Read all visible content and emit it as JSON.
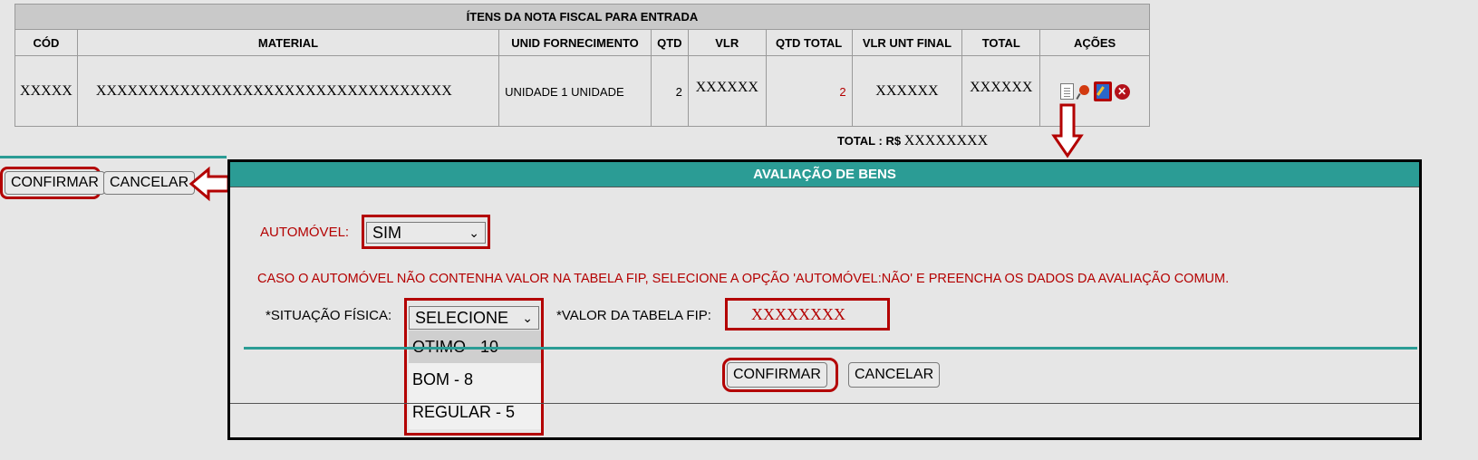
{
  "items_table": {
    "title": "ÍTENS DA NOTA FISCAL PARA ENTRADA",
    "columns": [
      "CÓD",
      "MATERIAL",
      "UNID FORNECIMENTO",
      "QTD",
      "VLR",
      "QTD TOTAL",
      "VLR UNT FINAL",
      "TOTAL",
      "AÇÕES"
    ],
    "row": {
      "cod": "XXXXX",
      "material": "XXXXXXXXXXXXXXXXXXXXXXXXXXXXXXXXXX",
      "unid": "UNIDADE 1 UNIDADE",
      "qtd": "2",
      "vlr": "XXXXXX",
      "qtd_total": "2",
      "vlr_unt_final": "XXXXXX",
      "total": "XXXXXX"
    },
    "action_icons": [
      "document-icon",
      "pin-icon",
      "edit-icon",
      "delete-icon"
    ]
  },
  "total": {
    "label": "TOTAL : R$",
    "value": "XXXXXXXX"
  },
  "left_buttons": {
    "confirm": "CONFIRMAR",
    "cancel": "CANCELAR"
  },
  "modal": {
    "title": "AVALIAÇÃO DE BENS",
    "automovel_label": "AUTOMÓVEL:",
    "automovel_value": "SIM",
    "notice": "CASO O AUTOMÓVEL NÃO CONTENHA VALOR NA TABELA FIP, SELECIONE A OPÇÃO 'AUTOMÓVEL:NÃO' E PREENCHA OS DADOS DA AVALIAÇÃO COMUM.",
    "situacao_label": "*SITUAÇÃO FÍSICA:",
    "situacao_value": "SELECIONE",
    "situacao_options": [
      "OTIMO - 10",
      "BOM - 8",
      "REGULAR - 5"
    ],
    "fip_label": "*VALOR DA TABELA FIP:",
    "fip_value": "XXXXXXXX",
    "confirm": "CONFIRMAR",
    "cancel": "CANCELAR"
  },
  "colors": {
    "teal": "#2b9c95",
    "highlight": "#b30000",
    "label_red": "#b40000"
  }
}
